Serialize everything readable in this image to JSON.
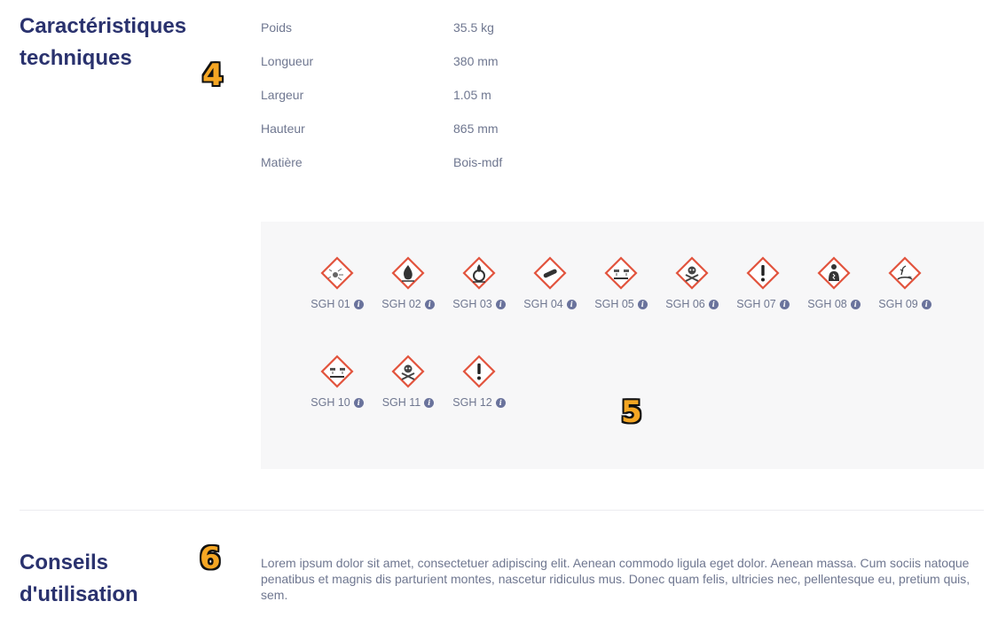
{
  "technical": {
    "title": "Caractéristiques techniques",
    "specs": [
      {
        "label": "Poids",
        "value": "35.5 kg"
      },
      {
        "label": "Longueur",
        "value": "380 mm"
      },
      {
        "label": "Largeur",
        "value": "1.05 m"
      },
      {
        "label": "Hauteur",
        "value": "865 mm"
      },
      {
        "label": "Matière",
        "value": "Bois-mdf"
      }
    ]
  },
  "hazards": {
    "accent_color": "#e2553f",
    "items": [
      {
        "code": "SGH 01",
        "icon": "exploding-bomb-icon"
      },
      {
        "code": "SGH 02",
        "icon": "flame-icon"
      },
      {
        "code": "SGH 03",
        "icon": "flame-over-circle-icon"
      },
      {
        "code": "SGH 04",
        "icon": "gas-cylinder-icon"
      },
      {
        "code": "SGH 05",
        "icon": "corrosion-icon"
      },
      {
        "code": "SGH 06",
        "icon": "skull-crossbones-icon"
      },
      {
        "code": "SGH 07",
        "icon": "exclamation-mark-icon"
      },
      {
        "code": "SGH 08",
        "icon": "health-hazard-icon"
      },
      {
        "code": "SGH 09",
        "icon": "environment-icon"
      },
      {
        "code": "SGH 10",
        "icon": "corrosion-icon"
      },
      {
        "code": "SGH 11",
        "icon": "skull-crossbones-icon"
      },
      {
        "code": "SGH 12",
        "icon": "exclamation-mark-icon"
      }
    ]
  },
  "conseils": {
    "title": "Conseils d'utilisation",
    "text": "Lorem ipsum dolor sit amet, consectetuer adipiscing elit. Aenean commodo ligula eget dolor. Aenean massa. Cum sociis natoque penatibus et magnis dis parturient montes, nascetur ridiculus mus. Donec quam felis, ultricies nec, pellentesque eu, pretium quis, sem."
  },
  "markers": {
    "m4": "4",
    "m5": "5",
    "m6": "6"
  }
}
